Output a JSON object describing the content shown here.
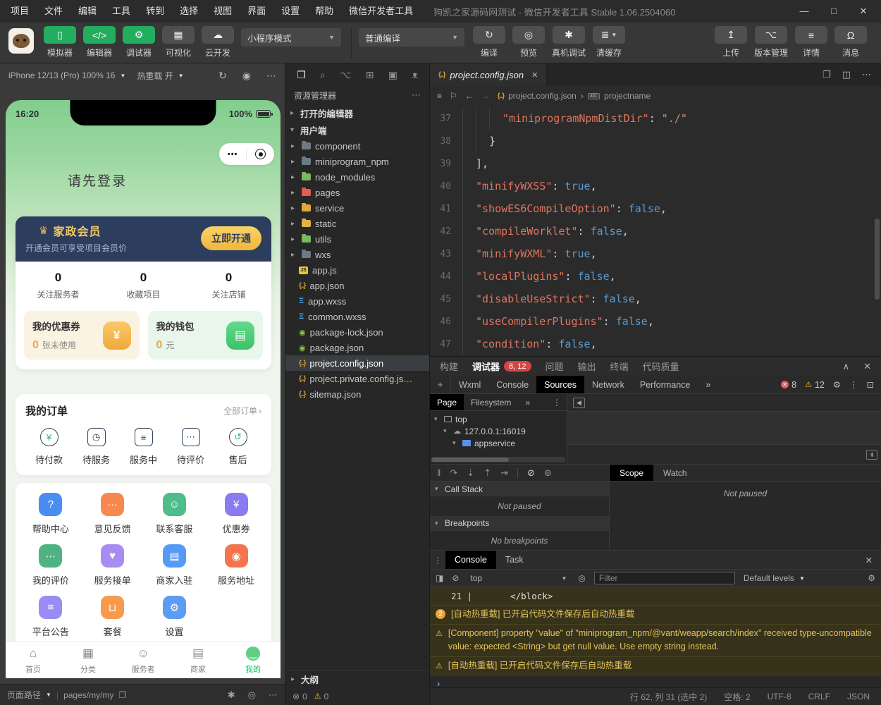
{
  "titlebar": {
    "menus": [
      "项目",
      "文件",
      "编辑",
      "工具",
      "转到",
      "选择",
      "视图",
      "界面",
      "设置",
      "帮助",
      "微信开发者工具"
    ],
    "title": "狗凯之家源码网测试 - 微信开发者工具 Stable 1.06.2504060",
    "window_controls": [
      {
        "name": "minimize",
        "glyph": "—"
      },
      {
        "name": "maximize",
        "glyph": "□"
      },
      {
        "name": "close",
        "glyph": "✕"
      }
    ]
  },
  "toolbar": {
    "app_buttons": [
      {
        "label": "模拟器",
        "icon": "simulator-phone-icon",
        "active": true
      },
      {
        "label": "编辑器",
        "icon": "editor-code-icon",
        "active": true
      },
      {
        "label": "调试器",
        "icon": "debug-sliders-icon",
        "active": true
      },
      {
        "label": "可视化",
        "icon": "visual-layout-icon",
        "active": false
      },
      {
        "label": "云开发",
        "icon": "cloud-icon",
        "active": false
      }
    ],
    "mode_dropdown": "小程序模式",
    "compile_dropdown": "普通编译",
    "compile_actions": [
      {
        "label": "编译",
        "icon": "refresh-icon",
        "caret": false
      },
      {
        "label": "预览",
        "icon": "eye-icon",
        "caret": false
      },
      {
        "label": "真机调试",
        "icon": "bug-icon",
        "caret": false
      },
      {
        "label": "清缓存",
        "icon": "layers-icon",
        "caret": true
      }
    ],
    "right_actions": [
      {
        "label": "上传",
        "icon": "upload-icon"
      },
      {
        "label": "版本管理",
        "icon": "branch-icon"
      },
      {
        "label": "详情",
        "icon": "details-menu-icon"
      },
      {
        "label": "消息",
        "icon": "bell-icon"
      }
    ]
  },
  "simulator": {
    "device_label": "iPhone 12/13 (Pro) 100% 16",
    "hot_reload_label": "热重载 开",
    "status_time": "16:20",
    "battery_percent": "100%",
    "capsule_dots": "•••",
    "login_prompt": "请先登录",
    "membership": {
      "title": "家政会员",
      "subtitle": "开通会员可享受项目会员价",
      "action": "立即开通"
    },
    "stats": [
      {
        "value": "0",
        "label": "关注服务者"
      },
      {
        "value": "0",
        "label": "收藏项目"
      },
      {
        "value": "0",
        "label": "关注店铺"
      }
    ],
    "assets": [
      {
        "title": "我的优惠券",
        "value": "0",
        "unit": "张未使用",
        "icon": "coupon-icon",
        "glyph": "¥"
      },
      {
        "title": "我的钱包",
        "value": "0",
        "unit": "元",
        "icon": "wallet-icon",
        "glyph": "▤"
      }
    ],
    "orders": {
      "title": "我的订单",
      "more": "全部订单",
      "chevron": "›",
      "items": [
        {
          "label": "待付款",
          "icon": "pay-icon"
        },
        {
          "label": "待服务",
          "icon": "pending-service-icon"
        },
        {
          "label": "服务中",
          "icon": "in-service-icon"
        },
        {
          "label": "待评价",
          "icon": "review-icon"
        },
        {
          "label": "售后",
          "icon": "aftersale-icon"
        }
      ]
    },
    "grid": [
      {
        "label": "帮助中心",
        "icon": "help-center-icon",
        "color": "#4a8cf0",
        "glyph": "?"
      },
      {
        "label": "意见反馈",
        "icon": "feedback-icon",
        "color": "#f7884e",
        "glyph": "⋯"
      },
      {
        "label": "联系客服",
        "icon": "contact-support-icon",
        "color": "#4fbd8a",
        "glyph": "☺"
      },
      {
        "label": "优惠券",
        "icon": "coupon-ticket-icon",
        "color": "#8a7cf0",
        "glyph": "¥"
      },
      {
        "label": "我的评价",
        "icon": "my-review-icon",
        "color": "#4db382",
        "glyph": "⋯"
      },
      {
        "label": "服务接单",
        "icon": "take-order-icon",
        "color": "#a78df2",
        "glyph": "♥"
      },
      {
        "label": "商家入驻",
        "icon": "merchant-join-icon",
        "color": "#549af6",
        "glyph": "▤"
      },
      {
        "label": "服务地址",
        "icon": "service-address-icon",
        "color": "#f4744e",
        "glyph": "◉"
      },
      {
        "label": "平台公告",
        "icon": "announcement-icon",
        "color": "#9a8cf5",
        "glyph": "≡"
      },
      {
        "label": "套餐",
        "icon": "package-icon",
        "color": "#f79a4d",
        "glyph": "⊔"
      },
      {
        "label": "设置",
        "icon": "settings-gear-icon",
        "color": "#5b9df5",
        "glyph": "⚙"
      }
    ],
    "tabbar": [
      {
        "label": "首页",
        "icon": "home-icon",
        "active": false
      },
      {
        "label": "分类",
        "icon": "category-icon",
        "active": false
      },
      {
        "label": "服务者",
        "icon": "worker-icon",
        "active": false
      },
      {
        "label": "商家",
        "icon": "shop-icon",
        "active": false
      },
      {
        "label": "我的",
        "icon": "me-icon",
        "active": true
      }
    ],
    "pagepath": {
      "label": "页面路径",
      "path": "pages/my/my"
    }
  },
  "explorer": {
    "activity_icons": [
      "files-icon",
      "search-icon",
      "source-control-icon",
      "extensions-icon",
      "window-icon",
      "pet-icon"
    ],
    "title": "资源管理器",
    "sections": {
      "open_editors": "打开的编辑器",
      "project": "用户端"
    },
    "tree": [
      {
        "name": "component",
        "kind": "folder",
        "color": "#6d7a85"
      },
      {
        "name": "miniprogram_npm",
        "kind": "folder",
        "color": "#6d7a85"
      },
      {
        "name": "node_modules",
        "kind": "folder",
        "color": "#7cb85c"
      },
      {
        "name": "pages",
        "kind": "folder",
        "color": "#e05d50"
      },
      {
        "name": "service",
        "kind": "folder",
        "color": "#e0a93e"
      },
      {
        "name": "static",
        "kind": "folder",
        "color": "#e0b345"
      },
      {
        "name": "utils",
        "kind": "folder",
        "color": "#7cb85c"
      },
      {
        "name": "wxs",
        "kind": "folder",
        "color": "#6d7a85"
      },
      {
        "name": "app.js",
        "kind": "js"
      },
      {
        "name": "app.json",
        "kind": "json"
      },
      {
        "name": "app.wxss",
        "kind": "wxss"
      },
      {
        "name": "common.wxss",
        "kind": "wxss"
      },
      {
        "name": "package-lock.json",
        "kind": "npm"
      },
      {
        "name": "package.json",
        "kind": "npm"
      },
      {
        "name": "project.config.json",
        "kind": "json",
        "selected": true
      },
      {
        "name": "project.private.config.js…",
        "kind": "json"
      },
      {
        "name": "sitemap.json",
        "kind": "json"
      }
    ],
    "outline_label": "大纲",
    "problems": {
      "errors": "0",
      "warnings": "0"
    }
  },
  "editor": {
    "tab_name": "project.config.json",
    "breadcrumb": {
      "file": "project.config.json",
      "separator": "›",
      "symbol": "projectname"
    },
    "code": [
      {
        "num": "37",
        "indent": 3,
        "tokens": [
          [
            "key",
            "\"miniprogramNpmDistDir\""
          ],
          [
            "p",
            ": "
          ],
          [
            "str",
            "\"./\""
          ]
        ]
      },
      {
        "num": "38",
        "indent": 2,
        "tokens": [
          [
            "p",
            "}"
          ]
        ]
      },
      {
        "num": "39",
        "indent": 1,
        "tokens": [
          [
            "p",
            "],"
          ]
        ]
      },
      {
        "num": "40",
        "indent": 1,
        "tokens": [
          [
            "key",
            "\"minifyWXSS\""
          ],
          [
            "p",
            ": "
          ],
          [
            "bool",
            "true"
          ],
          [
            "p",
            ","
          ]
        ]
      },
      {
        "num": "41",
        "indent": 1,
        "tokens": [
          [
            "key",
            "\"showES6CompileOption\""
          ],
          [
            "p",
            ": "
          ],
          [
            "bool",
            "false"
          ],
          [
            "p",
            ","
          ]
        ]
      },
      {
        "num": "42",
        "indent": 1,
        "tokens": [
          [
            "key",
            "\"compileWorklet\""
          ],
          [
            "p",
            ": "
          ],
          [
            "bool",
            "false"
          ],
          [
            "p",
            ","
          ]
        ]
      },
      {
        "num": "43",
        "indent": 1,
        "tokens": [
          [
            "key",
            "\"minifyWXML\""
          ],
          [
            "p",
            ": "
          ],
          [
            "bool",
            "true"
          ],
          [
            "p",
            ","
          ]
        ]
      },
      {
        "num": "44",
        "indent": 1,
        "tokens": [
          [
            "key",
            "\"localPlugins\""
          ],
          [
            "p",
            ": "
          ],
          [
            "bool",
            "false"
          ],
          [
            "p",
            ","
          ]
        ]
      },
      {
        "num": "45",
        "indent": 1,
        "tokens": [
          [
            "key",
            "\"disableUseStrict\""
          ],
          [
            "p",
            ": "
          ],
          [
            "bool",
            "false"
          ],
          [
            "p",
            ","
          ]
        ]
      },
      {
        "num": "46",
        "indent": 1,
        "tokens": [
          [
            "key",
            "\"useCompilerPlugins\""
          ],
          [
            "p",
            ": "
          ],
          [
            "bool",
            "false"
          ],
          [
            "p",
            ","
          ]
        ]
      },
      {
        "num": "47",
        "indent": 1,
        "tokens": [
          [
            "key",
            "\"condition\""
          ],
          [
            "p",
            ": "
          ],
          [
            "bool",
            "false"
          ],
          [
            "p",
            ","
          ]
        ]
      }
    ]
  },
  "debugger": {
    "panel_tabs": [
      {
        "label": "构建",
        "active": false
      },
      {
        "label": "调试器",
        "active": true,
        "badge": "8, 12"
      },
      {
        "label": "问题",
        "active": false
      },
      {
        "label": "输出",
        "active": false
      },
      {
        "label": "终端",
        "active": false
      },
      {
        "label": "代码质量",
        "active": false
      }
    ],
    "devtools_tabs": [
      "Wxml",
      "Console",
      "Sources",
      "Network",
      "Performance"
    ],
    "active_devtools_tab": "Sources",
    "error_count": "8",
    "warning_count": "12",
    "sources": {
      "subtabs": [
        "Page",
        "Filesystem"
      ],
      "active_subtab": "Page",
      "tree": [
        {
          "name": "top",
          "icon": "frame-icon"
        },
        {
          "name": "127.0.0.1:16019",
          "icon": "cloud-icon"
        },
        {
          "name": "appservice",
          "icon": "folder-icon"
        }
      ]
    },
    "scope_tabs": [
      "Scope",
      "Watch"
    ],
    "active_scope_tab": "Scope",
    "call_stack": {
      "title": "Call Stack",
      "empty": "Not paused"
    },
    "breakpoints": {
      "title": "Breakpoints",
      "empty": "No breakpoints"
    },
    "paused_state": "Not paused",
    "console": {
      "tabs": [
        "Console",
        "Task"
      ],
      "active_tab": "Console",
      "context": "top",
      "filter_placeholder": "Filter",
      "levels_label": "Default levels",
      "messages": [
        {
          "type": "code",
          "line": "21",
          "text": "</block>"
        },
        {
          "type": "info",
          "badge": "2",
          "text": "[自动热重载] 已开启代码文件保存后自动热重载"
        },
        {
          "type": "warning",
          "text": "[Component] property \"value\" of \"miniprogram_npm/@vant/weapp/search/index\" received type-uncompatible value: expected <String> but get null value. Use empty string instead."
        },
        {
          "type": "warning",
          "text": "[自动热重载] 已开启代码文件保存后自动热重载"
        }
      ],
      "prompt": "›"
    }
  },
  "statusbar": {
    "items": [
      "行 62, 列 31 (选中 2)",
      "空格: 2",
      "UTF-8",
      "CRLF",
      "JSON"
    ]
  },
  "colors": {
    "accent_green": "#07c160",
    "gold": "#f2c96a",
    "navy": "#2d3d5e",
    "warning_yellow": "#e2c35c",
    "error_red": "#d64545"
  }
}
